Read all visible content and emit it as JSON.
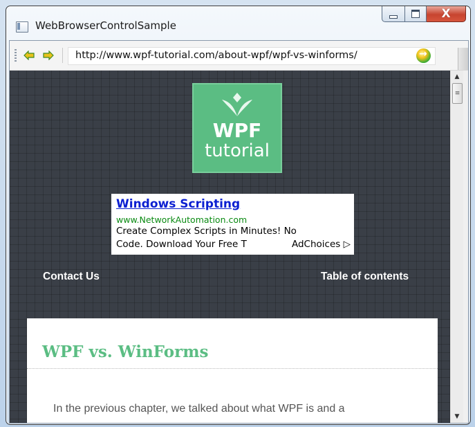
{
  "window": {
    "title": "WebBrowserControlSample",
    "minimize_label": "—",
    "maximize_label": "□",
    "close_label": "X"
  },
  "toolbar": {
    "back_icon": "back-arrow-icon",
    "forward_icon": "forward-arrow-icon",
    "address": "http://www.wpf-tutorial.com/about-wpf/wpf-vs-winforms/",
    "go_icon": "go-icon"
  },
  "page": {
    "logo": {
      "line1": "WPF",
      "line2": "tutorial",
      "color": "#5bbd83"
    },
    "ad": {
      "title": "Windows Scripting",
      "url": "www.NetworkAutomation.com",
      "line1": "Create Complex Scripts in Minutes! No",
      "line2": "Code. Download Your Free T",
      "choices": "AdChoices"
    },
    "nav": {
      "left": "Contact Us",
      "right": "Table of contents"
    },
    "article": {
      "title": "WPF vs. WinForms",
      "first_line": "In the previous chapter, we talked about what WPF is and a"
    },
    "background_color": "#3a3f47"
  },
  "scrollbar": {
    "up_icon": "▲",
    "down_icon": "▼",
    "thumb_icon": "≡"
  }
}
